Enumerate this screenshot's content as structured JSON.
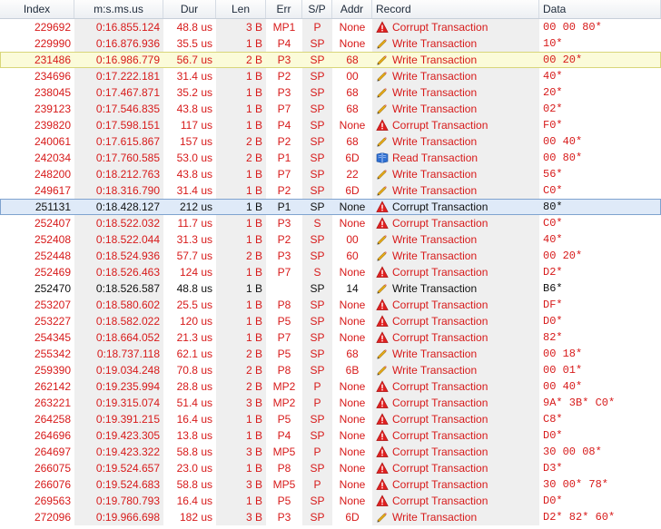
{
  "columns": [
    "Index",
    "m:s.ms.us",
    "Dur",
    "Len",
    "Err",
    "S/P",
    "Addr",
    "Record",
    "Data"
  ],
  "rows": [
    {
      "index": "229692",
      "time": "0:16.855.124",
      "dur": "48.8 us",
      "len": "3 B",
      "err": "MP1",
      "sp": "P",
      "addr": "None",
      "icon": "warning-icon",
      "record": "Corrupt Transaction",
      "data": "00 00 80*",
      "color": "red"
    },
    {
      "index": "229990",
      "time": "0:16.876.936",
      "dur": "35.5 us",
      "len": "1 B",
      "err": "P4",
      "sp": "SP",
      "addr": "None",
      "icon": "pencil-icon",
      "record": "Write Transaction",
      "data": "10*",
      "color": "red"
    },
    {
      "index": "231486",
      "time": "0:16.986.779",
      "dur": "56.7 us",
      "len": "2 B",
      "err": "P3",
      "sp": "SP",
      "addr": "68",
      "icon": "pencil-icon",
      "record": "Write Transaction",
      "data": "00 20*",
      "color": "red",
      "highlight": "yellow"
    },
    {
      "index": "234696",
      "time": "0:17.222.181",
      "dur": "31.4 us",
      "len": "1 B",
      "err": "P2",
      "sp": "SP",
      "addr": "00",
      "icon": "pencil-icon",
      "record": "Write Transaction",
      "data": "40*",
      "color": "red"
    },
    {
      "index": "238045",
      "time": "0:17.467.871",
      "dur": "35.2 us",
      "len": "1 B",
      "err": "P3",
      "sp": "SP",
      "addr": "68",
      "icon": "pencil-icon",
      "record": "Write Transaction",
      "data": "20*",
      "color": "red"
    },
    {
      "index": "239123",
      "time": "0:17.546.835",
      "dur": "43.8 us",
      "len": "1 B",
      "err": "P7",
      "sp": "SP",
      "addr": "68",
      "icon": "pencil-icon",
      "record": "Write Transaction",
      "data": "02*",
      "color": "red"
    },
    {
      "index": "239820",
      "time": "0:17.598.151",
      "dur": "117 us",
      "len": "1 B",
      "err": "P4",
      "sp": "SP",
      "addr": "None",
      "icon": "warning-icon",
      "record": "Corrupt Transaction",
      "data": "F0*",
      "color": "red"
    },
    {
      "index": "240061",
      "time": "0:17.615.867",
      "dur": "157 us",
      "len": "2 B",
      "err": "P2",
      "sp": "SP",
      "addr": "68",
      "icon": "pencil-icon",
      "record": "Write Transaction",
      "data": "00 40*",
      "color": "red"
    },
    {
      "index": "242034",
      "time": "0:17.760.585",
      "dur": "53.0 us",
      "len": "2 B",
      "err": "P1",
      "sp": "SP",
      "addr": "6D",
      "icon": "book-icon",
      "record": "Read Transaction",
      "data": "00 80*",
      "color": "red"
    },
    {
      "index": "248200",
      "time": "0:18.212.763",
      "dur": "43.8 us",
      "len": "1 B",
      "err": "P7",
      "sp": "SP",
      "addr": "22",
      "icon": "pencil-icon",
      "record": "Write Transaction",
      "data": "56*",
      "color": "red"
    },
    {
      "index": "249617",
      "time": "0:18.316.790",
      "dur": "31.4 us",
      "len": "1 B",
      "err": "P2",
      "sp": "SP",
      "addr": "6D",
      "icon": "pencil-icon",
      "record": "Write Transaction",
      "data": "C0*",
      "color": "red"
    },
    {
      "index": "251131",
      "time": "0:18.428.127",
      "dur": "212 us",
      "len": "1 B",
      "err": "P1",
      "sp": "SP",
      "addr": "None",
      "icon": "warning-icon",
      "record": "Corrupt Transaction",
      "data": "80*",
      "color": "black",
      "highlight": "blue"
    },
    {
      "index": "252407",
      "time": "0:18.522.032",
      "dur": "11.7 us",
      "len": "1 B",
      "err": "P3",
      "sp": "S",
      "addr": "None",
      "icon": "warning-icon",
      "record": "Corrupt Transaction",
      "data": "C0*",
      "color": "red"
    },
    {
      "index": "252408",
      "time": "0:18.522.044",
      "dur": "31.3 us",
      "len": "1 B",
      "err": "P2",
      "sp": "SP",
      "addr": "00",
      "icon": "pencil-icon",
      "record": "Write Transaction",
      "data": "40*",
      "color": "red"
    },
    {
      "index": "252448",
      "time": "0:18.524.936",
      "dur": "57.7 us",
      "len": "2 B",
      "err": "P3",
      "sp": "SP",
      "addr": "60",
      "icon": "pencil-icon",
      "record": "Write Transaction",
      "data": "00 20*",
      "color": "red"
    },
    {
      "index": "252469",
      "time": "0:18.526.463",
      "dur": "124 us",
      "len": "1 B",
      "err": "P7",
      "sp": "S",
      "addr": "None",
      "icon": "warning-icon",
      "record": "Corrupt Transaction",
      "data": "D2*",
      "color": "red"
    },
    {
      "index": "252470",
      "time": "0:18.526.587",
      "dur": "48.8 us",
      "len": "1 B",
      "err": "",
      "sp": "SP",
      "addr": "14",
      "icon": "pencil-icon",
      "record": "Write Transaction",
      "data": "B6*",
      "color": "black"
    },
    {
      "index": "253207",
      "time": "0:18.580.602",
      "dur": "25.5 us",
      "len": "1 B",
      "err": "P8",
      "sp": "SP",
      "addr": "None",
      "icon": "warning-icon",
      "record": "Corrupt Transaction",
      "data": "DF*",
      "color": "red"
    },
    {
      "index": "253227",
      "time": "0:18.582.022",
      "dur": "120 us",
      "len": "1 B",
      "err": "P5",
      "sp": "SP",
      "addr": "None",
      "icon": "warning-icon",
      "record": "Corrupt Transaction",
      "data": "D0*",
      "color": "red"
    },
    {
      "index": "254345",
      "time": "0:18.664.052",
      "dur": "21.3 us",
      "len": "1 B",
      "err": "P7",
      "sp": "SP",
      "addr": "None",
      "icon": "warning-icon",
      "record": "Corrupt Transaction",
      "data": "82*",
      "color": "red"
    },
    {
      "index": "255342",
      "time": "0:18.737.118",
      "dur": "62.1 us",
      "len": "2 B",
      "err": "P5",
      "sp": "SP",
      "addr": "68",
      "icon": "pencil-icon",
      "record": "Write Transaction",
      "data": "00 18*",
      "color": "red"
    },
    {
      "index": "259390",
      "time": "0:19.034.248",
      "dur": "70.8 us",
      "len": "2 B",
      "err": "P8",
      "sp": "SP",
      "addr": "6B",
      "icon": "pencil-icon",
      "record": "Write Transaction",
      "data": "00 01*",
      "color": "red"
    },
    {
      "index": "262142",
      "time": "0:19.235.994",
      "dur": "28.8 us",
      "len": "2 B",
      "err": "MP2",
      "sp": "P",
      "addr": "None",
      "icon": "warning-icon",
      "record": "Corrupt Transaction",
      "data": "00 40*",
      "color": "red"
    },
    {
      "index": "263221",
      "time": "0:19.315.074",
      "dur": "51.4 us",
      "len": "3 B",
      "err": "MP2",
      "sp": "P",
      "addr": "None",
      "icon": "warning-icon",
      "record": "Corrupt Transaction",
      "data": "9A* 3B* C0*",
      "color": "red"
    },
    {
      "index": "264258",
      "time": "0:19.391.215",
      "dur": "16.4 us",
      "len": "1 B",
      "err": "P5",
      "sp": "SP",
      "addr": "None",
      "icon": "warning-icon",
      "record": "Corrupt Transaction",
      "data": "C8*",
      "color": "red"
    },
    {
      "index": "264696",
      "time": "0:19.423.305",
      "dur": "13.8 us",
      "len": "1 B",
      "err": "P4",
      "sp": "SP",
      "addr": "None",
      "icon": "warning-icon",
      "record": "Corrupt Transaction",
      "data": "D0*",
      "color": "red"
    },
    {
      "index": "264697",
      "time": "0:19.423.322",
      "dur": "58.8 us",
      "len": "3 B",
      "err": "MP5",
      "sp": "P",
      "addr": "None",
      "icon": "warning-icon",
      "record": "Corrupt Transaction",
      "data": "30 00 08*",
      "color": "red"
    },
    {
      "index": "266075",
      "time": "0:19.524.657",
      "dur": "23.0 us",
      "len": "1 B",
      "err": "P8",
      "sp": "SP",
      "addr": "None",
      "icon": "warning-icon",
      "record": "Corrupt Transaction",
      "data": "D3*",
      "color": "red"
    },
    {
      "index": "266076",
      "time": "0:19.524.683",
      "dur": "58.8 us",
      "len": "3 B",
      "err": "MP5",
      "sp": "P",
      "addr": "None",
      "icon": "warning-icon",
      "record": "Corrupt Transaction",
      "data": "30 00* 78*",
      "color": "red"
    },
    {
      "index": "269563",
      "time": "0:19.780.793",
      "dur": "16.4 us",
      "len": "1 B",
      "err": "P5",
      "sp": "SP",
      "addr": "None",
      "icon": "warning-icon",
      "record": "Corrupt Transaction",
      "data": "D0*",
      "color": "red"
    },
    {
      "index": "272096",
      "time": "0:19.966.698",
      "dur": "182 us",
      "len": "3 B",
      "err": "P3",
      "sp": "SP",
      "addr": "6D",
      "icon": "pencil-icon",
      "record": "Write Transaction",
      "data": "D2* 82* 60*",
      "color": "red"
    }
  ]
}
